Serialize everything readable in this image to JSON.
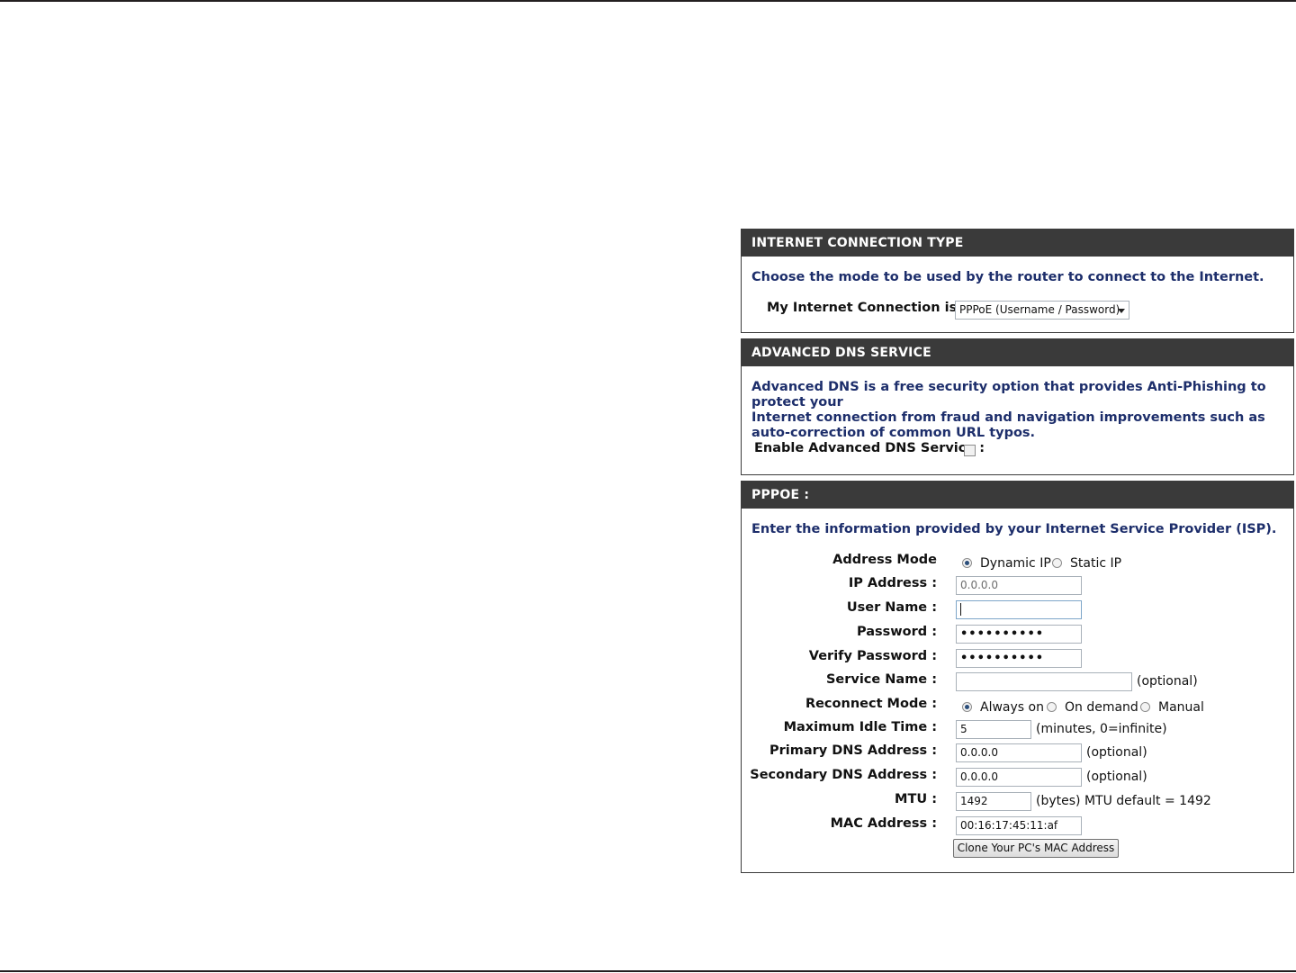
{
  "internet_connection": {
    "header": "INTERNET CONNECTION TYPE",
    "description": "Choose the mode to be used by the router to connect to the Internet.",
    "label": "My Internet Connection is :",
    "selected": "PPPoE (Username / Password)"
  },
  "advanced_dns": {
    "header": "ADVANCED DNS SERVICE",
    "description_lines": [
      "Advanced DNS is a free security option that provides Anti-Phishing to protect your",
      "Internet connection from fraud and navigation improvements such as",
      "auto-correction of common URL typos."
    ],
    "enable_label": "Enable Advanced DNS Service :",
    "enabled": false
  },
  "pppoe": {
    "header": "PPPOE :",
    "description": "Enter the information provided by your Internet Service Provider (ISP).",
    "address_mode": {
      "label": "Address Mode",
      "options": [
        "Dynamic IP",
        "Static IP"
      ],
      "selected": "Dynamic IP"
    },
    "ip_address": {
      "label": "IP Address :",
      "value": "0.0.0.0"
    },
    "user_name": {
      "label": "User Name :",
      "value": ""
    },
    "password": {
      "label": "Password :",
      "masked": "••••••••••"
    },
    "verify_password": {
      "label": "Verify Password :",
      "masked": "••••••••••"
    },
    "service_name": {
      "label": "Service Name :",
      "value": "",
      "hint": "(optional)"
    },
    "reconnect_mode": {
      "label": "Reconnect Mode :",
      "options": [
        "Always on",
        "On demand",
        "Manual"
      ],
      "selected": "Always on"
    },
    "max_idle_time": {
      "label": "Maximum Idle Time :",
      "value": "5",
      "hint": "(minutes, 0=infinite)"
    },
    "primary_dns": {
      "label": "Primary DNS Address :",
      "value": "0.0.0.0",
      "hint": "(optional)"
    },
    "secondary_dns": {
      "label": "Secondary DNS Address :",
      "value": "0.0.0.0",
      "hint": "(optional)"
    },
    "mtu": {
      "label": "MTU :",
      "value": "1492",
      "hint": "(bytes) MTU default = 1492"
    },
    "mac_address": {
      "label": "MAC Address :",
      "value": "00:16:17:45:11:af"
    },
    "clone_button": "Clone Your PC's MAC Address"
  }
}
